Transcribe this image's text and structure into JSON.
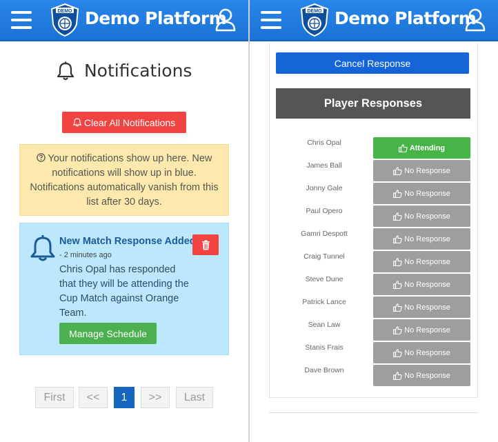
{
  "header": {
    "brand": "Demo Platform",
    "logo_text": "DEMO"
  },
  "notifications": {
    "title": "Notifications",
    "clear_all_label": "Clear All Notifications",
    "info_text": "Your notifications show up here. New notifications will show up in blue. Notifications automatically vanish from this list after 30 days.",
    "items": [
      {
        "title": "New Match Response Added",
        "time": "- 2 minutes ago",
        "body": "Chris Opal has responded that they will be attending the Cup Match against Orange Team.",
        "action_label": "Manage Schedule"
      }
    ],
    "pagination": {
      "first": "First",
      "prev": "<<",
      "current": "1",
      "next": ">>",
      "last": "Last"
    }
  },
  "responses": {
    "cancel_label": "Cancel Response",
    "header": "Player Responses",
    "players": [
      {
        "name": "Chris Opal",
        "status": "Attending"
      },
      {
        "name": "James Ball",
        "status": "No Response"
      },
      {
        "name": "Jonny Gale",
        "status": "No Response"
      },
      {
        "name": "Paul Opero",
        "status": "No Response"
      },
      {
        "name": "Gamri Despott",
        "status": "No Response"
      },
      {
        "name": "Craig Tunnel",
        "status": "No Response"
      },
      {
        "name": "Steve Dune",
        "status": "No Response"
      },
      {
        "name": "Patrick Lance",
        "status": "No Response"
      },
      {
        "name": "Sean Law",
        "status": "No Response"
      },
      {
        "name": "Stanis Frais",
        "status": "No Response"
      },
      {
        "name": "Dave Brown",
        "status": "No Response"
      }
    ]
  },
  "colors": {
    "header_blue": "#1e7be0",
    "danger_red": "#f24343",
    "success_green": "#4caf50",
    "info_yellow": "#fde9ae",
    "notification_blue": "#bde7fb",
    "no_response_grey": "#9e9e9e"
  }
}
